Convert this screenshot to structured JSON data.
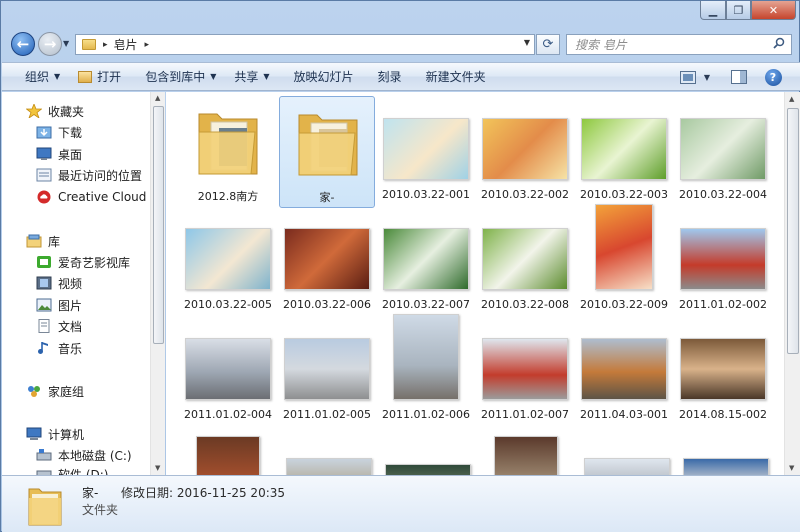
{
  "window": {
    "controls": {
      "minimize": "▁",
      "maximize": "❐",
      "close": "✕"
    }
  },
  "nav": {
    "breadcrumb_arrow": "▸",
    "path": "皂片",
    "search_placeholder": "搜索 皂片"
  },
  "toolbar": {
    "organize": "组织",
    "open": "打开",
    "include": "包含到库中",
    "share": "共享",
    "slideshow": "放映幻灯片",
    "burn": "刻录",
    "new_folder": "新建文件夹",
    "help": "?"
  },
  "sidebar": {
    "favorites": {
      "header": "收藏夹",
      "items": [
        "下载",
        "桌面",
        "最近访问的位置",
        "Creative Cloud Fi"
      ]
    },
    "libraries": {
      "header": "库",
      "items": [
        "爱奇艺影视库",
        "视频",
        "图片",
        "文档",
        "音乐"
      ]
    },
    "homegroup": "家庭组",
    "computer": {
      "header": "计算机",
      "items": [
        "本地磁盘 (C:)",
        "软件 (D:)"
      ]
    }
  },
  "files": [
    {
      "name": "2012.8南方",
      "kind": "folder"
    },
    {
      "name": "家-",
      "kind": "folder",
      "selected": true
    },
    {
      "name": "2010.03.22-001",
      "kind": "photo"
    },
    {
      "name": "2010.03.22-002",
      "kind": "photo"
    },
    {
      "name": "2010.03.22-003",
      "kind": "photo"
    },
    {
      "name": "2010.03.22-004",
      "kind": "photo"
    },
    {
      "name": "2010.03.22-005",
      "kind": "photo"
    },
    {
      "name": "2010.03.22-006",
      "kind": "photo"
    },
    {
      "name": "2010.03.22-007",
      "kind": "photo"
    },
    {
      "name": "2010.03.22-008",
      "kind": "photo"
    },
    {
      "name": "2010.03.22-009",
      "kind": "photo"
    },
    {
      "name": "2011.01.02-002",
      "kind": "photo"
    },
    {
      "name": "2011.01.02-004",
      "kind": "photo"
    },
    {
      "name": "2011.01.02-005",
      "kind": "photo"
    },
    {
      "name": "2011.01.02-006",
      "kind": "photo"
    },
    {
      "name": "2011.01.02-007",
      "kind": "photo"
    },
    {
      "name": "2011.04.03-001",
      "kind": "photo"
    },
    {
      "name": "2014.08.15-002",
      "kind": "photo"
    }
  ],
  "details": {
    "name": "家-",
    "date_label": "修改日期:",
    "date_value": "2016-11-25 20:35",
    "type": "文件夹"
  },
  "colors": {
    "accent": "#3a6ea5",
    "selection": "#cde4f8",
    "folder": "#f3d27a"
  }
}
